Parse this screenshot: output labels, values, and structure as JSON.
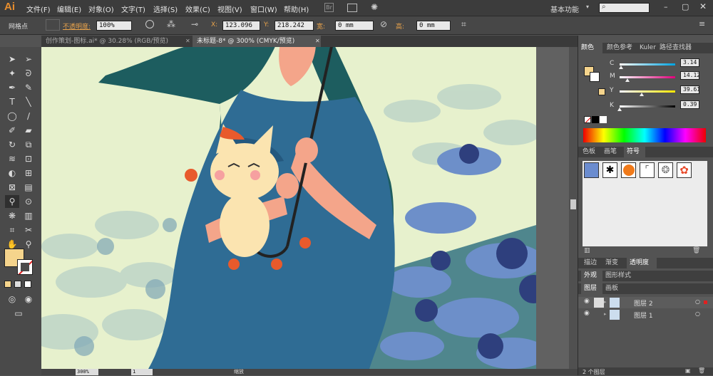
{
  "app": {
    "logo": "Ai"
  },
  "menu": [
    "文件(F)",
    "编辑(E)",
    "对象(O)",
    "文字(T)",
    "选择(S)",
    "效果(C)",
    "视图(V)",
    "窗口(W)",
    "帮助(H)"
  ],
  "workspace": "基本功能",
  "control": {
    "selection_label": "网格点",
    "opacity_label": "不透明度:",
    "opacity_value": "100%",
    "x_label": "X:",
    "x_value": "123.096",
    "y_label": "Y:",
    "y_value": "218.242",
    "w_label": "宽:",
    "w_value": "0 mm",
    "h_label": "高:",
    "h_value": "0 mm"
  },
  "doc_tabs": [
    {
      "label": "创作策划-图标.ai* @ 30.28% (RGB/预览)"
    },
    {
      "label": "未标题-8* @ 300% (CMYK/预览)"
    }
  ],
  "color_panel": {
    "tabs": [
      "颜色",
      "颜色参考",
      "Kuler",
      "路径查找器"
    ],
    "channels": [
      {
        "label": "C",
        "value": "3.14",
        "pct": 3.14
      },
      {
        "label": "M",
        "value": "14.12",
        "pct": 14.12
      },
      {
        "label": "Y",
        "value": "39.61",
        "pct": 39.61
      },
      {
        "label": "K",
        "value": "0.39",
        "pct": 0.39
      }
    ],
    "fill_color": "#f5d48c"
  },
  "swatch_panel": {
    "tabs": [
      "色板",
      "画笔",
      "符号"
    ]
  },
  "mid_panel": {
    "tabs": [
      "描边",
      "渐变",
      "透明度"
    ]
  },
  "appearance_panel": {
    "tabs": [
      "外观",
      "图形样式"
    ]
  },
  "layers_panel": {
    "tabs": [
      "图层",
      "画板"
    ],
    "layers": [
      {
        "name": "图层 2"
      },
      {
        "name": "图层 1"
      }
    ],
    "count": "2 个图层"
  },
  "status": {
    "zoom": "300%",
    "page": "1",
    "tool": "缩放"
  }
}
